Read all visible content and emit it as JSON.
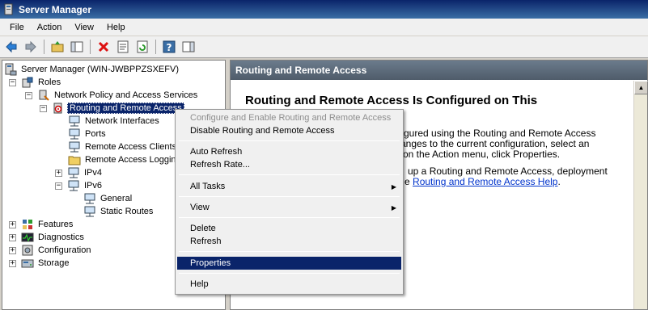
{
  "window": {
    "title": "Server Manager"
  },
  "menubar": {
    "items": [
      "File",
      "Action",
      "View",
      "Help"
    ]
  },
  "toolbar": {
    "icons": [
      "back-arrow-icon",
      "forward-arrow-icon",
      "up-folder-icon",
      "show-hide-tree-icon",
      "delete-icon",
      "properties-icon",
      "refresh-icon",
      "help-icon",
      "show-hide-action-pane-icon"
    ]
  },
  "tree": {
    "root": "Server Manager (WIN-JWBPPZSXEFV)",
    "roles": "Roles",
    "npas": "Network Policy and Access Services",
    "rras": "Routing and Remote Access",
    "network_interfaces": "Network Interfaces",
    "ports": "Ports",
    "remote_access_clients": "Remote Access Clients",
    "remote_access_logging": "Remote Access Logging",
    "ipv4": "IPv4",
    "ipv6": "IPv6",
    "general": "General",
    "static_routes": "Static Routes",
    "features": "Features",
    "diagnostics": "Diagnostics",
    "configuration": "Configuration",
    "storage": "Storage"
  },
  "right_pane": {
    "header": "Routing and Remote Access",
    "heading": "Routing and Remote Access Is Configured on This",
    "line1": "gured using the Routing and Remote Access",
    "line2": "anges to the current configuration, select an",
    "line3": "on the Action menu, click Properties.",
    "line4": "up a Routing and Remote Access, deployment",
    "line5_prefix": "e",
    "line5_link": "Routing and Remote Access Help",
    "line5_suffix": "."
  },
  "context_menu": {
    "items": [
      {
        "label": "Configure and Enable Routing and Remote Access",
        "disabled": true
      },
      {
        "label": "Disable Routing and Remote Access"
      },
      {
        "label": "Auto Refresh"
      },
      {
        "label": "Refresh Rate..."
      },
      {
        "label": "All Tasks",
        "submenu": true
      },
      {
        "label": "View",
        "submenu": true
      },
      {
        "label": "Delete"
      },
      {
        "label": "Refresh"
      },
      {
        "label": "Properties",
        "highlighted": true
      },
      {
        "label": "Help"
      }
    ]
  },
  "colors": {
    "selection": "#0a246a",
    "link": "#0033cc",
    "header_bg": "#5a6877"
  }
}
